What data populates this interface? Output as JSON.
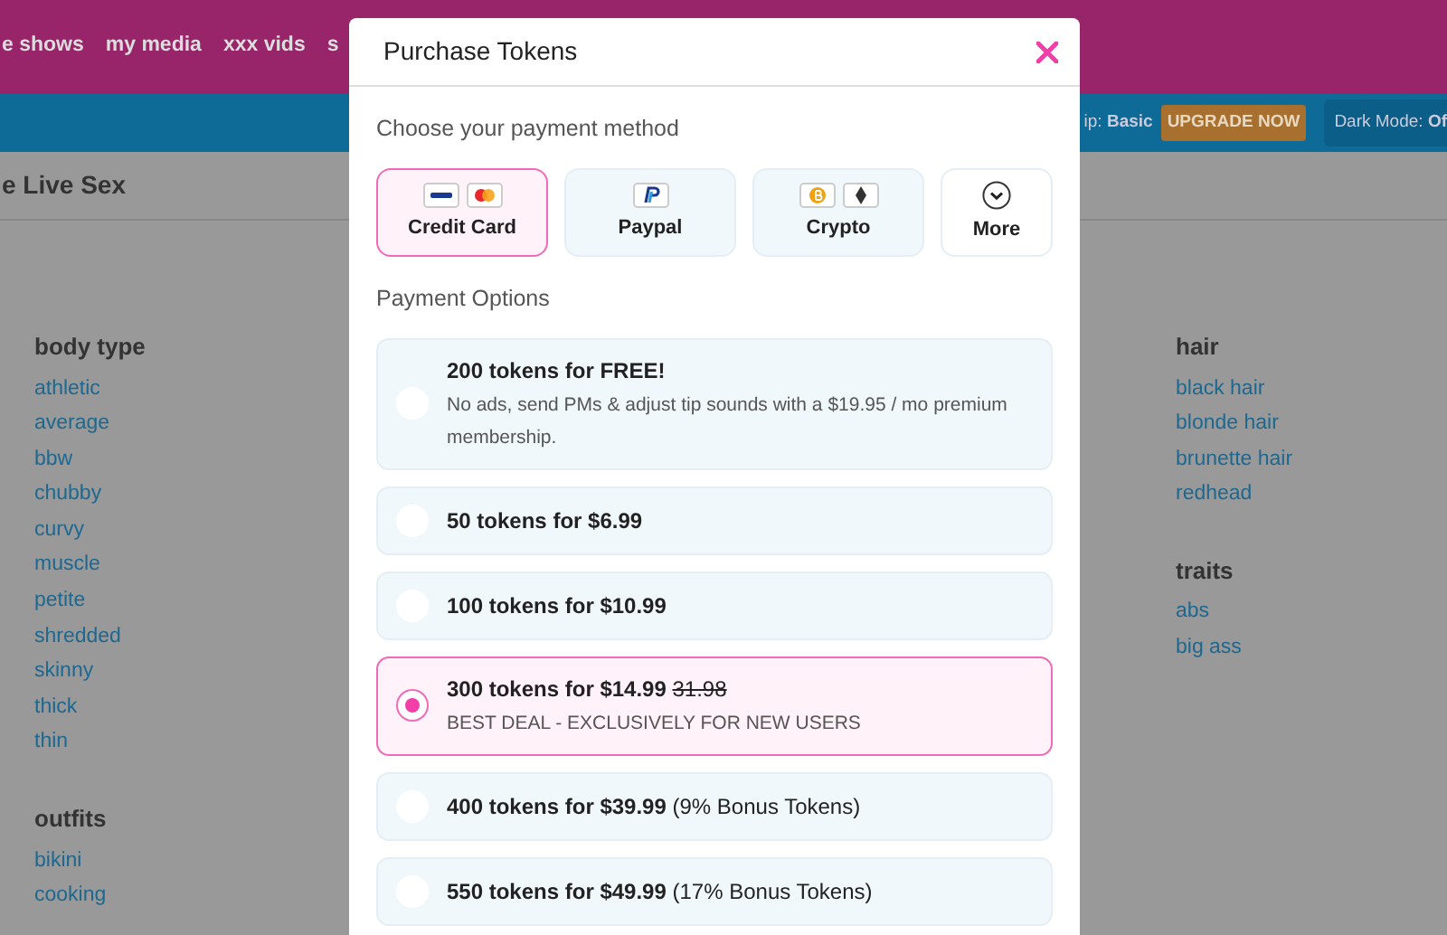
{
  "nav": {
    "links": [
      "e shows",
      "my media",
      "xxx vids",
      "s"
    ]
  },
  "subbar": {
    "membership": "ip: **Basic**",
    "upgrade": "UPGRADE NOW",
    "dark_mode": "Dark Mode: **Of**"
  },
  "page_title": "e Live Sex",
  "columns": [
    {
      "groups": [
        {
          "title": "body type",
          "items": [
            "athletic",
            "average",
            "bbw",
            "chubby",
            "curvy",
            "muscle",
            "petite",
            "shredded",
            "skinny",
            "thick",
            "thin"
          ]
        },
        {
          "title": "outfits",
          "items": [
            "bikini",
            "cooking"
          ]
        }
      ]
    },
    {
      "groups": [
        {
          "title": "hair",
          "items": [
            "black hair",
            "blonde hair",
            "brunette hair",
            "redhead"
          ]
        },
        {
          "title": "traits",
          "items": [
            "abs",
            "big ass"
          ]
        }
      ]
    }
  ],
  "modal": {
    "title": "Purchase Tokens",
    "method_heading": "Choose your payment method",
    "methods": [
      {
        "label": "Credit Card",
        "kind": "card",
        "selected": true
      },
      {
        "label": "Paypal",
        "kind": "paypal",
        "selected": false
      },
      {
        "label": "Crypto",
        "kind": "crypto",
        "selected": false
      },
      {
        "label": "More",
        "kind": "more",
        "selected": false
      }
    ],
    "options_heading": "Payment Options",
    "options": [
      {
        "title": "200 tokens for FREE!",
        "note": "No ads, send PMs & adjust tip sounds with a $19.95 / mo premium membership.",
        "selected": false
      },
      {
        "title": "50 tokens for $6.99",
        "selected": false
      },
      {
        "title": "100 tokens for $10.99",
        "selected": false
      },
      {
        "title": "300 tokens for $14.99",
        "old_price": "31.98",
        "note": "BEST DEAL - EXCLUSIVELY FOR NEW USERS",
        "selected": true
      },
      {
        "title": "400 tokens for $39.99",
        "bonus": "(9% Bonus Tokens)",
        "selected": false
      },
      {
        "title": "550 tokens for $49.99",
        "bonus": "(17% Bonus Tokens)",
        "selected": false
      }
    ]
  }
}
